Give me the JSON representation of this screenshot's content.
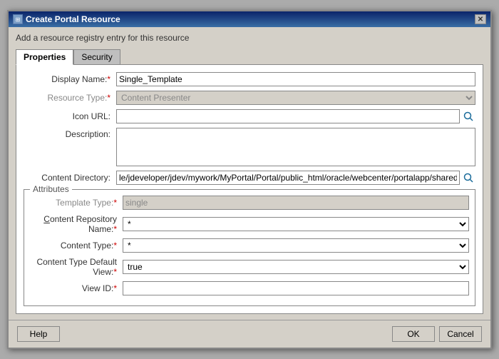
{
  "dialog": {
    "title": "Create Portal Resource",
    "subtitle": "Add a resource registry entry for this resource",
    "close_label": "✕"
  },
  "tabs": [
    {
      "id": "properties",
      "label": "Properties",
      "active": true
    },
    {
      "id": "security",
      "label": "Security",
      "active": false
    }
  ],
  "form": {
    "display_name_label": "Display Name:",
    "display_name_required": "*",
    "display_name_value": "Single_Template",
    "resource_type_label": "Resource Type:",
    "resource_type_required": "*",
    "resource_type_value": "Content Presenter",
    "icon_url_label": "Icon URL:",
    "icon_url_value": "",
    "description_label": "Description:",
    "description_value": "",
    "content_directory_label": "Content Directory:",
    "content_directory_value": "le/jdeveloper/jdev/mywork/MyPortal/Portal/public_html/oracle/webcenter/portalapp/shared/"
  },
  "attributes": {
    "legend": "Attributes",
    "template_type_label": "Template Type:",
    "template_type_required": "*",
    "template_type_value": "single",
    "content_repo_label": "Content Repository Name:",
    "content_repo_required": "*",
    "content_repo_value": "*",
    "content_repo_options": [
      "*"
    ],
    "content_type_label": "Content Type:",
    "content_type_required": "*",
    "content_type_value": "*",
    "content_type_options": [
      "*"
    ],
    "content_type_default_view_label": "Content Type Default View:",
    "content_type_default_view_required": "*",
    "content_type_default_view_value": "true",
    "content_type_default_view_options": [
      "true",
      "false"
    ],
    "view_id_label": "View ID:",
    "view_id_required": "*",
    "view_id_value": ""
  },
  "footer": {
    "help_label": "Help",
    "ok_label": "OK",
    "cancel_label": "Cancel"
  }
}
